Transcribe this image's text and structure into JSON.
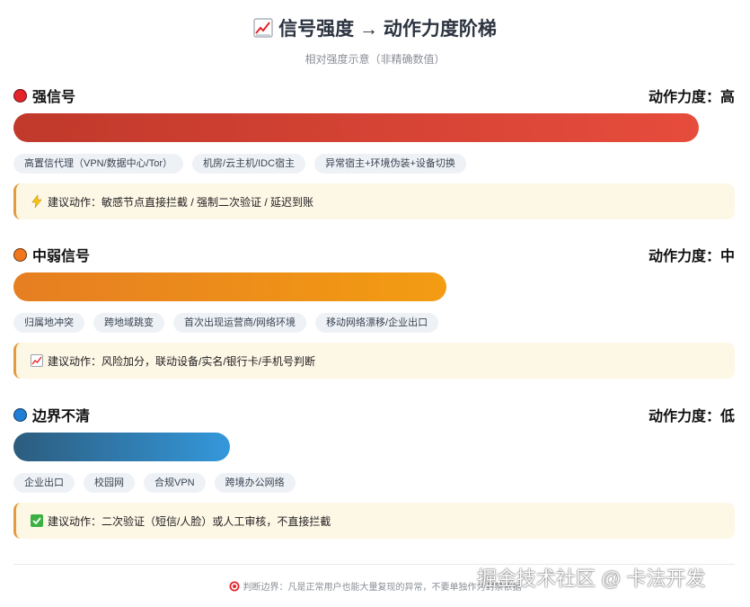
{
  "header": {
    "title": "信号强度 → 动作力度阶梯",
    "subtitle": "相对强度示意（非精确数值）",
    "title_icon": "chart-increasing-icon"
  },
  "sections": [
    {
      "label": "强信号",
      "force": "动作力度：高",
      "level": 0.95,
      "dot_color": "#e3242b",
      "bar_from": "#c0392b",
      "bar_to": "#e74c3c",
      "tags": [
        "高置信代理（VPN/数据中心/Tor）",
        "机房/云主机/IDC宿主",
        "异常宿主+环境伪装+设备切换"
      ],
      "advice_icon": "lightning-icon",
      "advice": "建议动作：敏感节点直接拦截 / 强制二次验证 / 延迟到账"
    },
    {
      "label": "中弱信号",
      "force": "动作力度：中",
      "level": 0.6,
      "dot_color": "#f0761e",
      "bar_from": "#e67e22",
      "bar_to": "#f39c12",
      "tags": [
        "归属地冲突",
        "跨地域跳变",
        "首次出现运营商/网络环境",
        "移动网络漂移/企业出口"
      ],
      "advice_icon": "chart-increasing-icon",
      "advice": "建议动作：风险加分，联动设备/实名/银行卡/手机号判断"
    },
    {
      "label": "边界不清",
      "force": "动作力度：低",
      "level": 0.3,
      "dot_color": "#1f7fd6",
      "bar_from": "#2c5c7e",
      "bar_to": "#3498db",
      "tags": [
        "企业出口",
        "校园网",
        "合规VPN",
        "跨境办公网络"
      ],
      "advice_icon": "check-mark-icon",
      "advice": "建议动作：二次验证（短信/人脸）或人工审核，不直接拦截"
    }
  ],
  "footer": {
    "icon": "target-icon",
    "text": "判断边界：凡是正常用户也能大量复现的异常，不要单独作为封禁依据"
  },
  "watermark": "掘金技术社区 @ 卡法开发"
}
